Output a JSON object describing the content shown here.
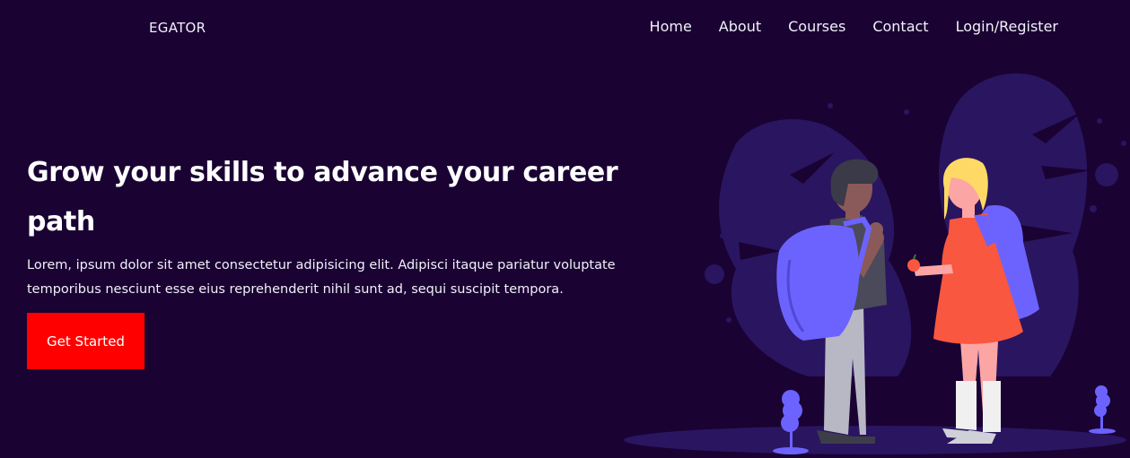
{
  "header": {
    "brand": "EGATOR",
    "nav": [
      "Home",
      "About",
      "Courses",
      "Contact",
      "Login/Register"
    ]
  },
  "hero": {
    "title": "Grow your skills to advance your career path",
    "description": "Lorem, ipsum dolor sit amet consectetur adipisicing elit. Adipisci itaque pariatur voluptate temporibus nesciunt esse eius reprehenderit nihil sunt ad, sequi suscipit tempora.",
    "cta_label": "Get Started"
  },
  "colors": {
    "background": "#1a0233",
    "cta": "#ff0000",
    "accent_purple": "#6c63ff",
    "blob_dark": "#2a1560",
    "dress": "#f9573f"
  },
  "illustration": {
    "icons": [
      "students-illustration",
      "boy-icon",
      "girl-icon",
      "backpack-icon",
      "apple-icon",
      "plant-icon"
    ]
  }
}
